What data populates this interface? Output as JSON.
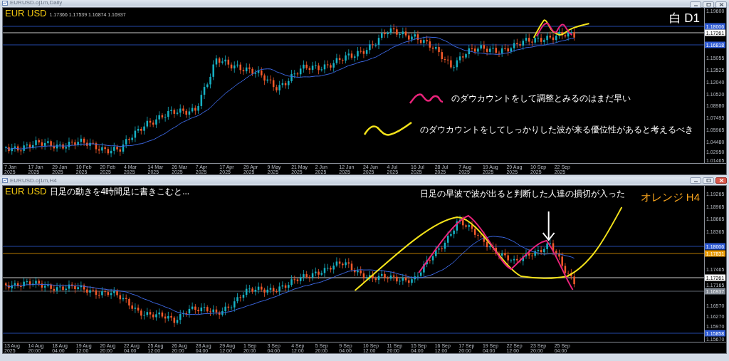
{
  "windows": [
    {
      "title": "EURUSD.oj1m,Daily",
      "active": false,
      "symbol": "EUR USD",
      "quote": "1.17366 1.17539 1.16874 1.16937",
      "caption": {
        "text": "白 D1",
        "color": "#ffffff"
      },
      "price_ticks": [
        "1.19600",
        "1.15055",
        "1.13525",
        "1.12040",
        "1.10520",
        "1.08980",
        "1.07495",
        "1.05965",
        "1.04480",
        "1.02950",
        "1.01465"
      ],
      "price_tags": [
        {
          "text": "1.18006",
          "color": "#2f5bd3"
        },
        {
          "text": "1.17261",
          "color": "#ffffff"
        },
        {
          "text": "1.16818",
          "color": "#2f5bd3"
        }
      ],
      "time_ticks": [
        "7 Jan 2025",
        "17 Jan 2025",
        "29 Jan 2025",
        "10 Feb 2025",
        "20 Feb 2025",
        "4 Mar 2025",
        "14 Mar 2025",
        "26 Mar 2025",
        "7 Apr 2025",
        "17 Apr 2025",
        "29 Apr 2025",
        "9 May 2025",
        "21 May 2025",
        "2 Jun 2025",
        "12 Jun 2025",
        "24 Jun 2025",
        "4 Jul 2025",
        "16 Jul 2025",
        "28 Jul 2025",
        "7 Aug 2025",
        "19 Aug 2025",
        "29 Aug 2025",
        "10 Sep 2025",
        "22 Sep 2025"
      ],
      "notes": [
        {
          "kind": "wave",
          "text": "のダウカウントをして調整とみるのはまだ早い"
        },
        {
          "kind": "curve",
          "text": "のダウカウントをしてしっかりした波が来る優位性があると考えるべき"
        }
      ]
    },
    {
      "title": "EURUSD.oj1m,H4",
      "active": true,
      "symbol": "EUR USD",
      "subtitle": "日足の動きを4時間足に書きこむと...",
      "callout": "日足の早波で波が出ると判断した人達の損切が入った",
      "caption": {
        "text": "オレンジ H4",
        "color": "#f5a21c"
      },
      "price_ticks": [
        "1.19265",
        "1.18965",
        "1.18665",
        "1.18365",
        "1.17465",
        "1.17165",
        "1.16570",
        "1.16270",
        "1.15970",
        "1.15670"
      ],
      "price_tags": [
        {
          "text": "1.18006",
          "color": "#2f5bd3"
        },
        {
          "text": "1.17831",
          "color": "#e89a00"
        },
        {
          "text": "1.17261",
          "color": "#ffffff"
        },
        {
          "text": "1.16937",
          "color": "#7d8590"
        },
        {
          "text": "1.15858",
          "color": "#2f5bd3"
        }
      ],
      "time_ticks": [
        "13 Aug 2025",
        "14 Aug 20:00",
        "18 Aug 04:00",
        "19 Aug 12:00",
        "20 Aug 20:00",
        "22 Aug 04:00",
        "25 Aug 12:00",
        "26 Aug 20:00",
        "28 Aug 04:00",
        "29 Aug 12:00",
        "1 Sep 20:00",
        "3 Sep 04:00",
        "4 Sep 12:00",
        "5 Sep 20:00",
        "9 Sep 04:00",
        "10 Sep 12:00",
        "11 Sep 20:00",
        "15 Sep 04:00",
        "16 Sep 12:00",
        "17 Sep 20:00",
        "19 Sep 04:00",
        "22 Sep 12:00",
        "23 Sep 20:00",
        "25 Sep 04:00"
      ]
    }
  ]
}
